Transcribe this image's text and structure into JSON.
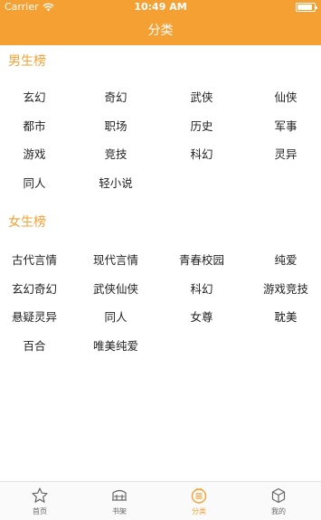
{
  "status_bar": {
    "carrier": "Carrier",
    "time": "10:49 AM",
    "battery_level": 0.9
  },
  "nav": {
    "title": "分类"
  },
  "colors": {
    "accent": "#f5a033",
    "text": "#222222",
    "tab_inactive": "#666666"
  },
  "male": {
    "title": "男生榜",
    "items": [
      "玄幻",
      "奇幻",
      "武侠",
      "仙侠",
      "都市",
      "职场",
      "历史",
      "军事",
      "游戏",
      "竞技",
      "科幻",
      "灵异",
      "同人",
      "轻小说"
    ]
  },
  "female": {
    "title": "女生榜",
    "items": [
      "古代言情",
      "现代言情",
      "青春校园",
      "纯爱",
      "玄幻奇幻",
      "武侠仙侠",
      "科幻",
      "游戏竞技",
      "悬疑灵异",
      "同人",
      "女尊",
      "耽美",
      "百合",
      "唯美纯爱"
    ]
  },
  "tabbar": {
    "active_index": 2,
    "tabs": [
      {
        "label": "首页",
        "icon": "home-icon"
      },
      {
        "label": "书架",
        "icon": "bookshelf-icon"
      },
      {
        "label": "分类",
        "icon": "category-icon"
      },
      {
        "label": "我的",
        "icon": "profile-icon"
      }
    ]
  }
}
